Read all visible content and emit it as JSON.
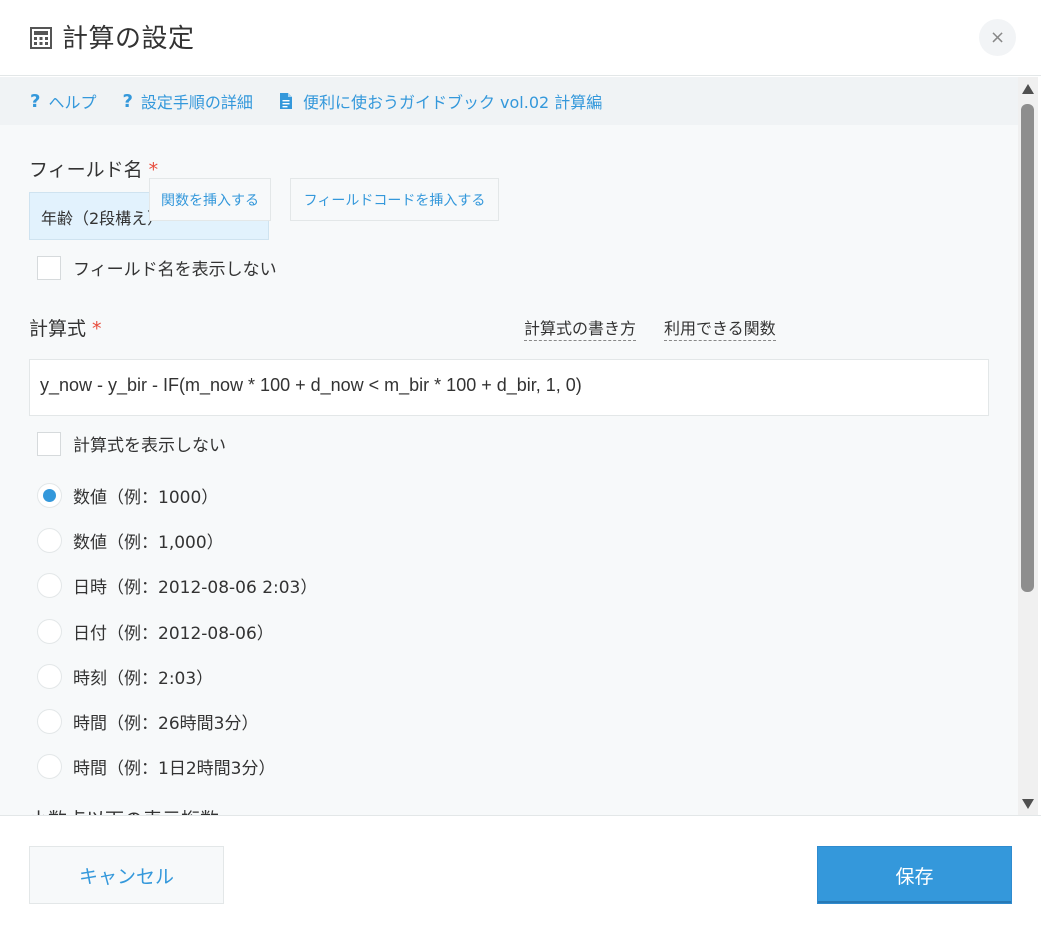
{
  "header": {
    "title": "計算の設定",
    "close_label": "×"
  },
  "help_links": [
    {
      "label": "ヘルプ"
    },
    {
      "label": "設定手順の詳細"
    },
    {
      "label": "便利に使おうガイドブック vol.02 計算編"
    }
  ],
  "field_name": {
    "label": "フィールド名",
    "required_mark": "*",
    "value": "年齢（2段構え）",
    "hide_checkbox_label": "フィールド名を表示しない",
    "hide_checked": false
  },
  "formula": {
    "label": "計算式",
    "required_mark": "*",
    "insert_function_label": "関数を挿入する",
    "insert_field_code_label": "フィールドコードを挿入する",
    "how_to_write_label": "計算式の書き方",
    "available_functions_label": "利用できる関数",
    "value": "y_now - y_bir - IF(m_now * 100 + d_now < m_bir * 100 + d_bir, 1, 0)",
    "hide_checkbox_label": "計算式を表示しない",
    "hide_checked": false
  },
  "format_options": [
    {
      "label": "数値（例：1000）",
      "checked": true
    },
    {
      "label": "数値（例：1,000）",
      "checked": false
    },
    {
      "label": "日時（例：2012-08-06 2:03）",
      "checked": false
    },
    {
      "label": "日付（例：2012-08-06）",
      "checked": false
    },
    {
      "label": "時刻（例：2:03）",
      "checked": false
    },
    {
      "label": "時間（例：26時間3分）",
      "checked": false
    },
    {
      "label": "時間（例：1日2時間3分）",
      "checked": false
    }
  ],
  "decimal_label": "小数点以下の表示桁数",
  "footer": {
    "cancel_label": "キャンセル",
    "save_label": "保存"
  },
  "colors": {
    "accent": "#3498db",
    "required": "#e74c3c",
    "input_highlight": "#e2f2fd"
  }
}
